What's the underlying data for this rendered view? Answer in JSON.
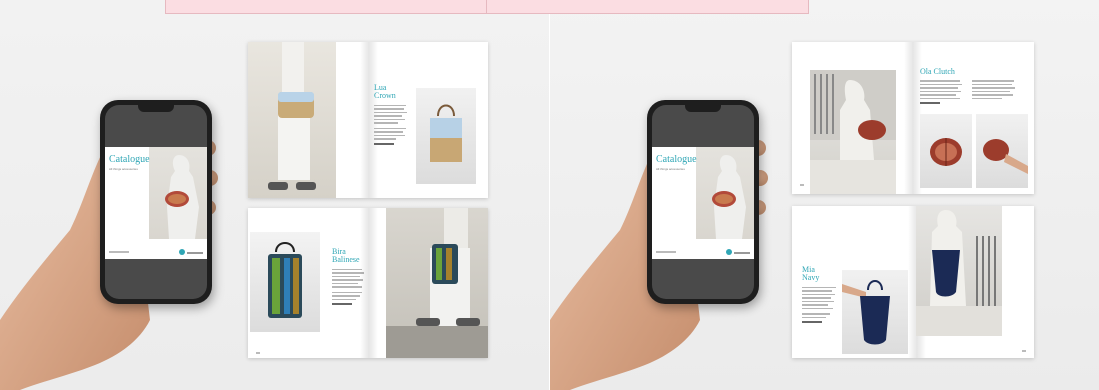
{
  "left_scene": {
    "phone": {
      "catalog_title": "Catalogue",
      "catalog_subtitle": "All things accessories"
    },
    "spread_top": {
      "product_name": "Lua Crown"
    },
    "spread_bottom": {
      "product_name": "Bira\nBalinese"
    }
  },
  "right_scene": {
    "phone": {
      "catalog_title": "Catalogue",
      "catalog_subtitle": "All things accessories"
    },
    "spread_top": {
      "product_name": "Ola Clutch"
    },
    "spread_bottom": {
      "product_name": "Mia\nNavy"
    }
  },
  "colors": {
    "accent_teal": "#2fa6b5",
    "top_strip_pink": "#fbdde2",
    "phone_body": "#1e1e1e",
    "skin": "#d8a88a"
  }
}
